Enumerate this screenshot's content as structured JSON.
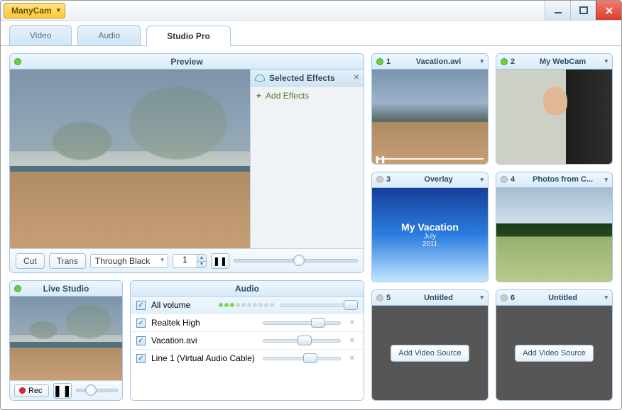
{
  "app_title": "ManyCam",
  "tabs": {
    "video": "Video",
    "audio": "Audio",
    "studio": "Studio Pro"
  },
  "preview": {
    "title": "Preview",
    "selected_effects": "Selected Effects",
    "add_effects": "Add Effects",
    "cut": "Cut",
    "trans": "Trans",
    "transition_mode": "Through Black",
    "trans_count": "1"
  },
  "live_studio": {
    "title": "Live Studio",
    "rec": "Rec"
  },
  "audio_panel": {
    "title": "Audio",
    "rows": [
      {
        "name": "All volume",
        "knob": 82,
        "vu": true
      },
      {
        "name": "Realtek High",
        "knob": 62
      },
      {
        "name": "Vacation.avi",
        "knob": 45
      },
      {
        "name": "Line 1 (Virtual Audio Cable)",
        "knob": 52
      }
    ]
  },
  "sources": [
    {
      "num": "1",
      "title": "Vacation.avi",
      "kind": "landscape",
      "live": true,
      "progress": true
    },
    {
      "num": "2",
      "title": "My WebCam",
      "kind": "webcam",
      "live": true
    },
    {
      "num": "3",
      "title": "Overlay",
      "kind": "overlay",
      "overlay_title": "My Vacation",
      "overlay_sub1": "July",
      "overlay_sub2": "2011"
    },
    {
      "num": "4",
      "title": "Photos from C...",
      "kind": "photos"
    },
    {
      "num": "5",
      "title": "Untitled",
      "kind": "empty",
      "add_label": "Add Video Source"
    },
    {
      "num": "6",
      "title": "Untitled",
      "kind": "empty",
      "add_label": "Add Video Source"
    }
  ]
}
